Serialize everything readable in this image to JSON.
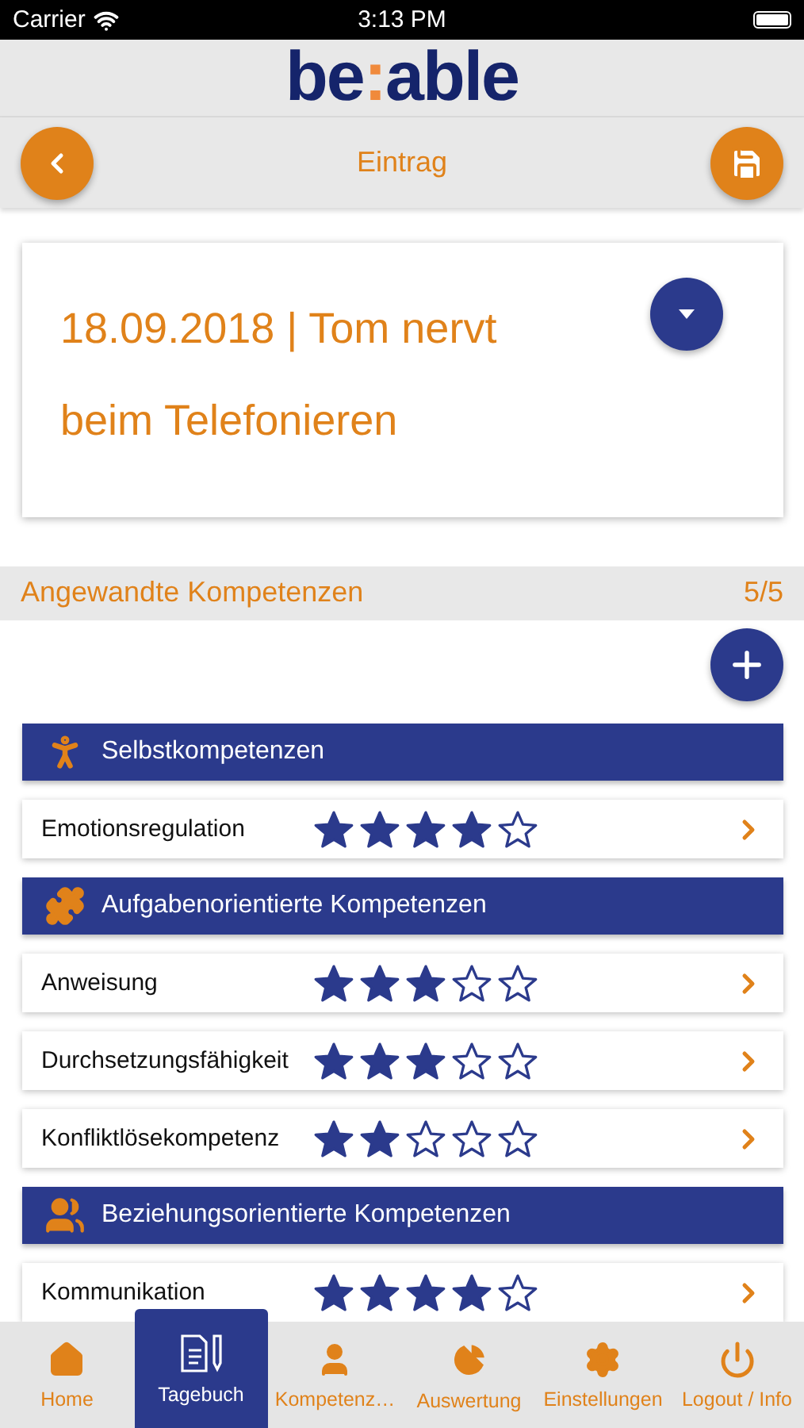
{
  "status_bar": {
    "carrier": "Carrier",
    "time": "3:13 PM"
  },
  "logo": {
    "parts": [
      {
        "text": "be",
        "accent": false
      },
      {
        "text": ":",
        "accent": true
      },
      {
        "text": "able",
        "accent": false
      }
    ]
  },
  "nav": {
    "title": "Eintrag"
  },
  "entry": {
    "title": "18.09.2018 | Tom nervt beim Telefonieren"
  },
  "section": {
    "title": "Angewandte Kompetenzen",
    "count": "5/5"
  },
  "groups": [
    {
      "kind": "self",
      "title": "Selbstkompetenzen",
      "items": [
        {
          "name": "Emotionsregulation",
          "stars": 4
        }
      ]
    },
    {
      "kind": "task",
      "title": "Aufgabenorientierte Kompetenzen",
      "items": [
        {
          "name": "Anweisung",
          "stars": 3
        },
        {
          "name": "Durchsetzungsfähigkeit",
          "stars": 3
        },
        {
          "name": "Konfliktlösekompetenz",
          "stars": 2
        }
      ]
    },
    {
      "kind": "relation",
      "title": "Beziehungsorientierte Kompetenzen",
      "items": [
        {
          "name": "Kommunikation",
          "stars": 4
        }
      ]
    }
  ],
  "tabs": [
    {
      "kind": "home",
      "label": "Home",
      "selected": false
    },
    {
      "kind": "diary",
      "label": "Tagebuch",
      "selected": true
    },
    {
      "kind": "person",
      "label": "Kompetenz…",
      "selected": false
    },
    {
      "kind": "chart",
      "label": "Auswertung",
      "selected": false
    },
    {
      "kind": "settings",
      "label": "Einstellungen",
      "selected": false
    },
    {
      "kind": "logout",
      "label": "Logout / Info",
      "selected": false
    }
  ]
}
